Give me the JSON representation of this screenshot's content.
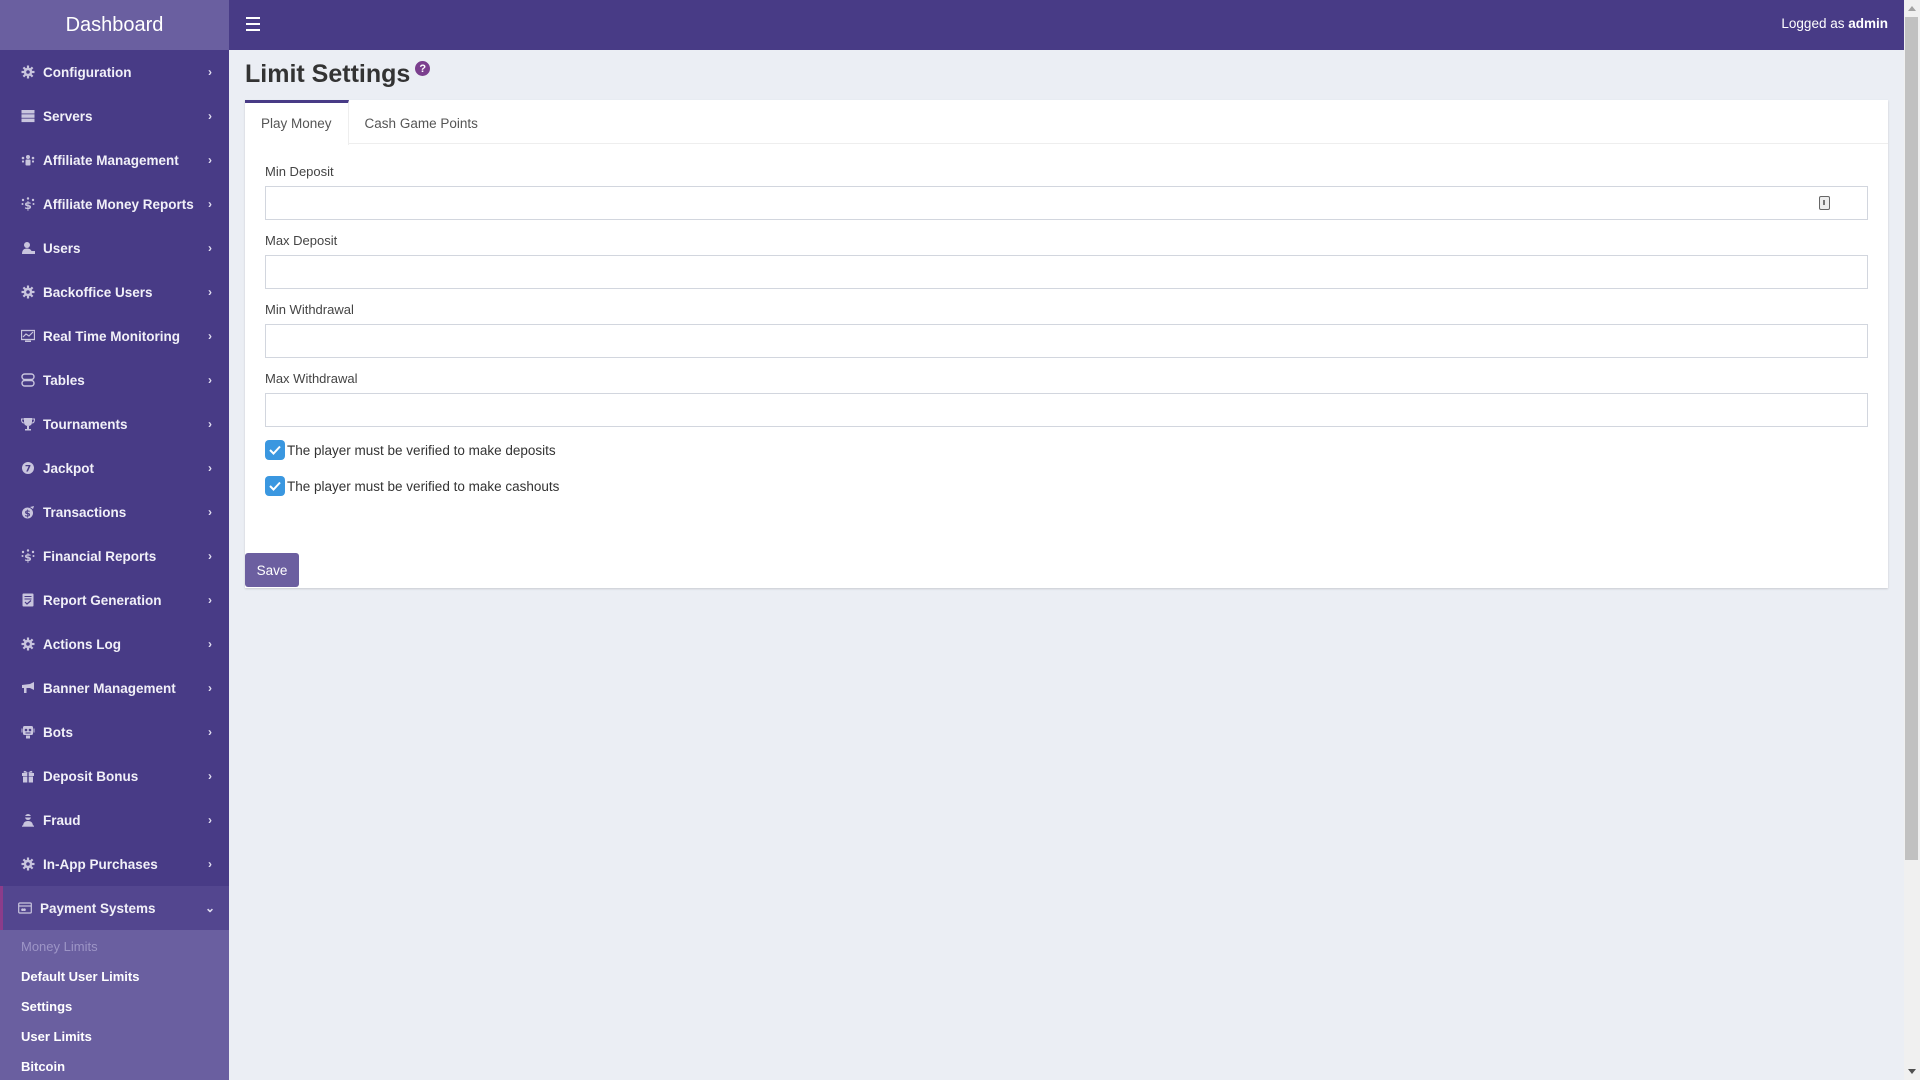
{
  "sidebar": {
    "brand": "Dashboard",
    "items": [
      {
        "label": "Configuration",
        "icon": "gear-icon"
      },
      {
        "label": "Servers",
        "icon": "server-icon"
      },
      {
        "label": "Affiliate Management",
        "icon": "users-group-icon"
      },
      {
        "label": "Affiliate Money Reports",
        "icon": "money-report-icon"
      },
      {
        "label": "Users",
        "icon": "user-icon"
      },
      {
        "label": "Backoffice Users",
        "icon": "gear-icon"
      },
      {
        "label": "Real Time Monitoring",
        "icon": "monitor-chart-icon"
      },
      {
        "label": "Tables",
        "icon": "tables-icon"
      },
      {
        "label": "Tournaments",
        "icon": "trophy-icon"
      },
      {
        "label": "Jackpot",
        "icon": "jackpot-icon"
      },
      {
        "label": "Transactions",
        "icon": "money-bag-icon"
      },
      {
        "label": "Financial Reports",
        "icon": "money-report-icon"
      },
      {
        "label": "Report Generation",
        "icon": "report-icon"
      },
      {
        "label": "Actions Log",
        "icon": "gear-icon"
      },
      {
        "label": "Banner Management",
        "icon": "megaphone-icon"
      },
      {
        "label": "Bots",
        "icon": "robot-icon"
      },
      {
        "label": "Deposit Bonus",
        "icon": "gift-icon"
      },
      {
        "label": "Fraud",
        "icon": "thief-icon"
      },
      {
        "label": "In-App Purchases",
        "icon": "gear-icon"
      },
      {
        "label": "Payment Systems",
        "icon": "credit-card-icon",
        "expanded": true
      }
    ],
    "submenu": [
      {
        "label": "Money Limits",
        "muted": true
      },
      {
        "label": "Default User Limits"
      },
      {
        "label": "Settings"
      },
      {
        "label": "User Limits"
      },
      {
        "label": "Bitcoin"
      }
    ]
  },
  "header": {
    "logged_prefix": "Logged as",
    "user": "admin"
  },
  "page": {
    "title": "Limit Settings",
    "help_glyph": "?"
  },
  "tabs": [
    {
      "label": "Play Money",
      "active": true
    },
    {
      "label": "Cash Game Points",
      "active": false
    }
  ],
  "form": {
    "fields": [
      {
        "label": "Min Deposit",
        "value": "",
        "placeholder": ""
      },
      {
        "label": "Max Deposit",
        "value": "",
        "placeholder": ""
      },
      {
        "label": "Min Withdrawal",
        "value": "",
        "placeholder": ""
      },
      {
        "label": "Max Withdrawal",
        "value": "",
        "placeholder": ""
      }
    ],
    "checkboxes": [
      {
        "label": "The player must be verified to make deposits",
        "checked": true
      },
      {
        "label": "The player must be verified to make cashouts",
        "checked": true
      }
    ],
    "save_label": "Save"
  },
  "colors": {
    "sidebar_bg": "#483b86",
    "brand_bg": "#6a5fa0",
    "accent": "#7b3f8e",
    "checkbox": "#3a97e0",
    "button": "#6c5fa0"
  }
}
